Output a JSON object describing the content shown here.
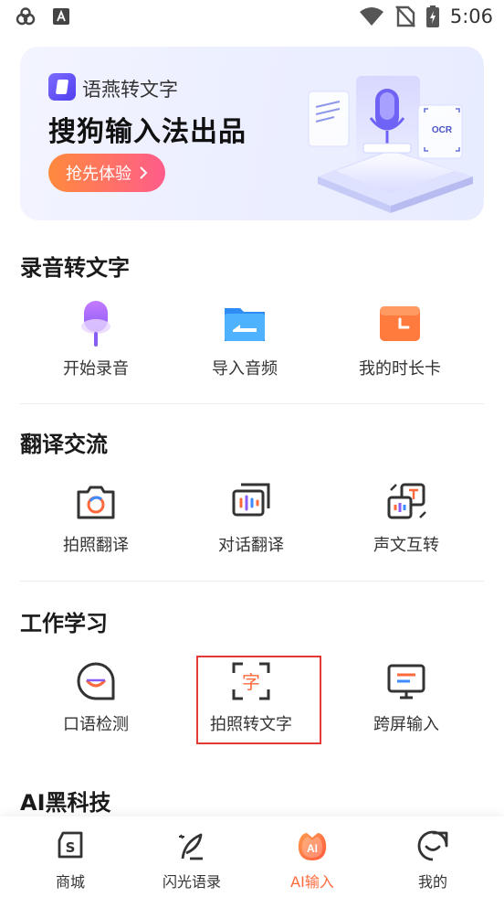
{
  "status_bar": {
    "time": "5:06"
  },
  "banner": {
    "brand_name": "语燕转文字",
    "title": "搜狗输入法出品",
    "cta_label": "抢先体验",
    "art_badge": "OCR"
  },
  "sections": [
    {
      "title": "录音转文字",
      "items": [
        {
          "label": "开始录音",
          "icon": "microphone-icon"
        },
        {
          "label": "导入音频",
          "icon": "folder-icon"
        },
        {
          "label": "我的时长卡",
          "icon": "clock-card-icon"
        }
      ]
    },
    {
      "title": "翻译交流",
      "items": [
        {
          "label": "拍照翻译",
          "icon": "camera-translate-icon"
        },
        {
          "label": "对话翻译",
          "icon": "dialog-translate-icon"
        },
        {
          "label": "声文互转",
          "icon": "voice-text-convert-icon"
        }
      ]
    },
    {
      "title": "工作学习",
      "items": [
        {
          "label": "口语检测",
          "icon": "speaking-test-icon"
        },
        {
          "label": "拍照转文字",
          "icon": "photo-to-text-icon",
          "icon_char": "字"
        },
        {
          "label": "跨屏输入",
          "icon": "cross-screen-icon"
        }
      ]
    },
    {
      "title": "AI黑科技",
      "items": []
    }
  ],
  "bottom_nav": [
    {
      "label": "商城",
      "icon": "store-icon",
      "icon_char": "S"
    },
    {
      "label": "闪光语录",
      "icon": "feather-icon"
    },
    {
      "label": "AI输入",
      "icon": "ai-input-icon",
      "icon_char": "AI",
      "active": true
    },
    {
      "label": "我的",
      "icon": "profile-icon"
    }
  ],
  "colors": {
    "accent_orange": "#ff6a3c",
    "highlight_red": "#e53935",
    "purple": "#8a5cf6"
  }
}
